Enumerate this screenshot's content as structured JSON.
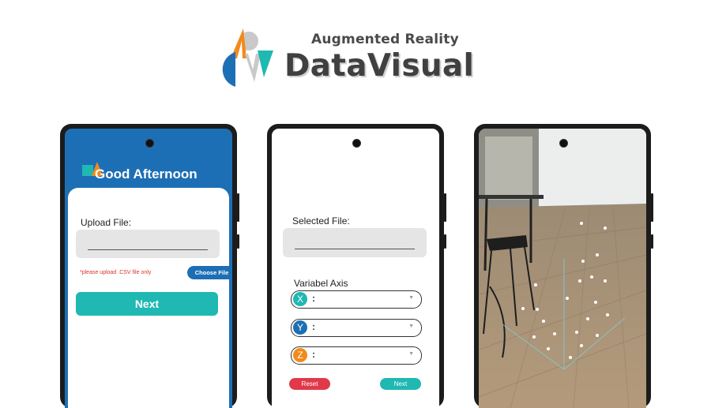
{
  "logo": {
    "subtitle": "Augmented Reality",
    "title": "DataVisual",
    "colors": {
      "orange": "#f28a1c",
      "blue": "#1d6fb5",
      "teal": "#1fb8b3",
      "grey": "#c9c9c9"
    }
  },
  "screen_upload": {
    "greeting": "Good Afternoon",
    "upload_label": "Upload File:",
    "file_value": "",
    "warning": "*please upload .CSV file only",
    "choose_button": "Choose File",
    "next_button": "Next"
  },
  "screen_axes": {
    "selected_label": "Selected File:",
    "file_value": "",
    "axis_title": "Variabel Axis",
    "axes": [
      {
        "letter": "X",
        "sep": ":",
        "value": "",
        "color": "#1fb8b3"
      },
      {
        "letter": "Y",
        "sep": ":",
        "value": "",
        "color": "#1d6fb5"
      },
      {
        "letter": "Z",
        "sep": ":",
        "value": "",
        "color": "#f28a1c"
      }
    ],
    "reset_button": "Reset",
    "next_button": "Next"
  },
  "screen_ar": {
    "description_icon": "ar-scatter-plot"
  },
  "theme": {
    "primary": "#1d6fb5",
    "accent": "#1fb8b3",
    "danger": "#e0394a",
    "warning_text": "#e0302a"
  }
}
